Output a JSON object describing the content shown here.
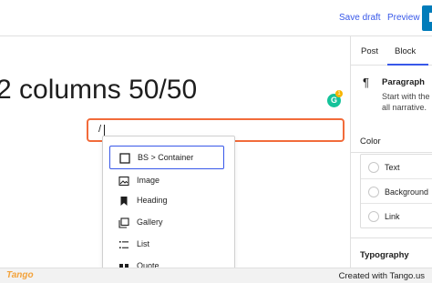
{
  "header": {
    "save_draft": "Save draft",
    "preview": "Preview"
  },
  "sidebar": {
    "tabs": [
      {
        "label": "Post"
      },
      {
        "label": "Block"
      }
    ],
    "active_tab": "Block",
    "block": {
      "name": "Paragraph",
      "description_line1": "Start with the b",
      "description_line2": "all narrative."
    },
    "color": {
      "title": "Color",
      "items": [
        {
          "label": "Text"
        },
        {
          "label": "Background"
        },
        {
          "label": "Link"
        }
      ]
    },
    "typography_title": "Typography"
  },
  "editor": {
    "title": "2 columns 50/50",
    "slash_input_value": "/",
    "grammarly_badge": "G",
    "grammarly_count": "1"
  },
  "inserter": {
    "items": [
      {
        "label": "BS > Container",
        "icon": "square-icon",
        "selected": true
      },
      {
        "label": "Image",
        "icon": "image-icon",
        "selected": false
      },
      {
        "label": "Heading",
        "icon": "bookmark-icon",
        "selected": false
      },
      {
        "label": "Gallery",
        "icon": "gallery-icon",
        "selected": false
      },
      {
        "label": "List",
        "icon": "list-icon",
        "selected": false
      },
      {
        "label": "Quote",
        "icon": "quote-icon",
        "selected": false
      }
    ]
  },
  "footer": {
    "brand": "Tango",
    "created_with": "Created with Tango.us"
  },
  "colors": {
    "accent": "#3858e9",
    "highlight_border": "#f26b3a",
    "publish": "#007cba",
    "brand": "#f3a23a"
  }
}
